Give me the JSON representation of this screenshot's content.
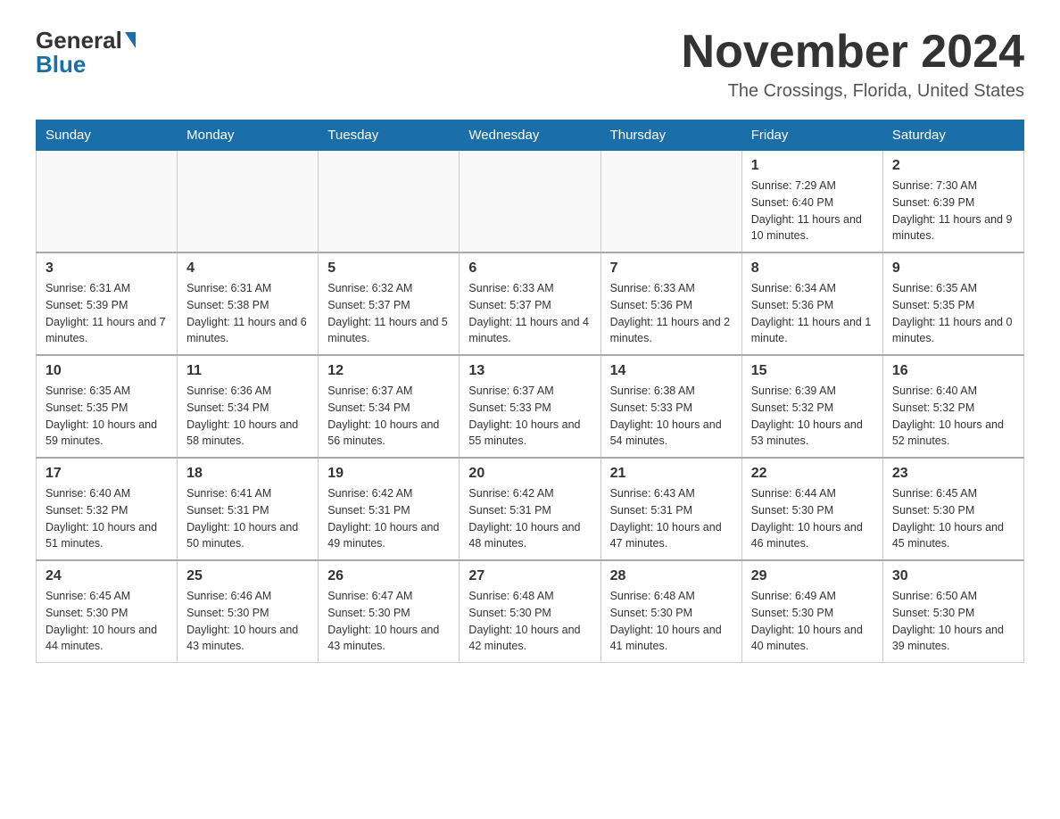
{
  "header": {
    "logo_general": "General",
    "logo_blue": "Blue",
    "month_title": "November 2024",
    "location": "The Crossings, Florida, United States"
  },
  "days_of_week": [
    "Sunday",
    "Monday",
    "Tuesday",
    "Wednesday",
    "Thursday",
    "Friday",
    "Saturday"
  ],
  "weeks": [
    {
      "days": [
        {
          "num": "",
          "info": ""
        },
        {
          "num": "",
          "info": ""
        },
        {
          "num": "",
          "info": ""
        },
        {
          "num": "",
          "info": ""
        },
        {
          "num": "",
          "info": ""
        },
        {
          "num": "1",
          "info": "Sunrise: 7:29 AM\nSunset: 6:40 PM\nDaylight: 11 hours and 10 minutes."
        },
        {
          "num": "2",
          "info": "Sunrise: 7:30 AM\nSunset: 6:39 PM\nDaylight: 11 hours and 9 minutes."
        }
      ]
    },
    {
      "days": [
        {
          "num": "3",
          "info": "Sunrise: 6:31 AM\nSunset: 5:39 PM\nDaylight: 11 hours and 7 minutes."
        },
        {
          "num": "4",
          "info": "Sunrise: 6:31 AM\nSunset: 5:38 PM\nDaylight: 11 hours and 6 minutes."
        },
        {
          "num": "5",
          "info": "Sunrise: 6:32 AM\nSunset: 5:37 PM\nDaylight: 11 hours and 5 minutes."
        },
        {
          "num": "6",
          "info": "Sunrise: 6:33 AM\nSunset: 5:37 PM\nDaylight: 11 hours and 4 minutes."
        },
        {
          "num": "7",
          "info": "Sunrise: 6:33 AM\nSunset: 5:36 PM\nDaylight: 11 hours and 2 minutes."
        },
        {
          "num": "8",
          "info": "Sunrise: 6:34 AM\nSunset: 5:36 PM\nDaylight: 11 hours and 1 minute."
        },
        {
          "num": "9",
          "info": "Sunrise: 6:35 AM\nSunset: 5:35 PM\nDaylight: 11 hours and 0 minutes."
        }
      ]
    },
    {
      "days": [
        {
          "num": "10",
          "info": "Sunrise: 6:35 AM\nSunset: 5:35 PM\nDaylight: 10 hours and 59 minutes."
        },
        {
          "num": "11",
          "info": "Sunrise: 6:36 AM\nSunset: 5:34 PM\nDaylight: 10 hours and 58 minutes."
        },
        {
          "num": "12",
          "info": "Sunrise: 6:37 AM\nSunset: 5:34 PM\nDaylight: 10 hours and 56 minutes."
        },
        {
          "num": "13",
          "info": "Sunrise: 6:37 AM\nSunset: 5:33 PM\nDaylight: 10 hours and 55 minutes."
        },
        {
          "num": "14",
          "info": "Sunrise: 6:38 AM\nSunset: 5:33 PM\nDaylight: 10 hours and 54 minutes."
        },
        {
          "num": "15",
          "info": "Sunrise: 6:39 AM\nSunset: 5:32 PM\nDaylight: 10 hours and 53 minutes."
        },
        {
          "num": "16",
          "info": "Sunrise: 6:40 AM\nSunset: 5:32 PM\nDaylight: 10 hours and 52 minutes."
        }
      ]
    },
    {
      "days": [
        {
          "num": "17",
          "info": "Sunrise: 6:40 AM\nSunset: 5:32 PM\nDaylight: 10 hours and 51 minutes."
        },
        {
          "num": "18",
          "info": "Sunrise: 6:41 AM\nSunset: 5:31 PM\nDaylight: 10 hours and 50 minutes."
        },
        {
          "num": "19",
          "info": "Sunrise: 6:42 AM\nSunset: 5:31 PM\nDaylight: 10 hours and 49 minutes."
        },
        {
          "num": "20",
          "info": "Sunrise: 6:42 AM\nSunset: 5:31 PM\nDaylight: 10 hours and 48 minutes."
        },
        {
          "num": "21",
          "info": "Sunrise: 6:43 AM\nSunset: 5:31 PM\nDaylight: 10 hours and 47 minutes."
        },
        {
          "num": "22",
          "info": "Sunrise: 6:44 AM\nSunset: 5:30 PM\nDaylight: 10 hours and 46 minutes."
        },
        {
          "num": "23",
          "info": "Sunrise: 6:45 AM\nSunset: 5:30 PM\nDaylight: 10 hours and 45 minutes."
        }
      ]
    },
    {
      "days": [
        {
          "num": "24",
          "info": "Sunrise: 6:45 AM\nSunset: 5:30 PM\nDaylight: 10 hours and 44 minutes."
        },
        {
          "num": "25",
          "info": "Sunrise: 6:46 AM\nSunset: 5:30 PM\nDaylight: 10 hours and 43 minutes."
        },
        {
          "num": "26",
          "info": "Sunrise: 6:47 AM\nSunset: 5:30 PM\nDaylight: 10 hours and 43 minutes."
        },
        {
          "num": "27",
          "info": "Sunrise: 6:48 AM\nSunset: 5:30 PM\nDaylight: 10 hours and 42 minutes."
        },
        {
          "num": "28",
          "info": "Sunrise: 6:48 AM\nSunset: 5:30 PM\nDaylight: 10 hours and 41 minutes."
        },
        {
          "num": "29",
          "info": "Sunrise: 6:49 AM\nSunset: 5:30 PM\nDaylight: 10 hours and 40 minutes."
        },
        {
          "num": "30",
          "info": "Sunrise: 6:50 AM\nSunset: 5:30 PM\nDaylight: 10 hours and 39 minutes."
        }
      ]
    }
  ]
}
